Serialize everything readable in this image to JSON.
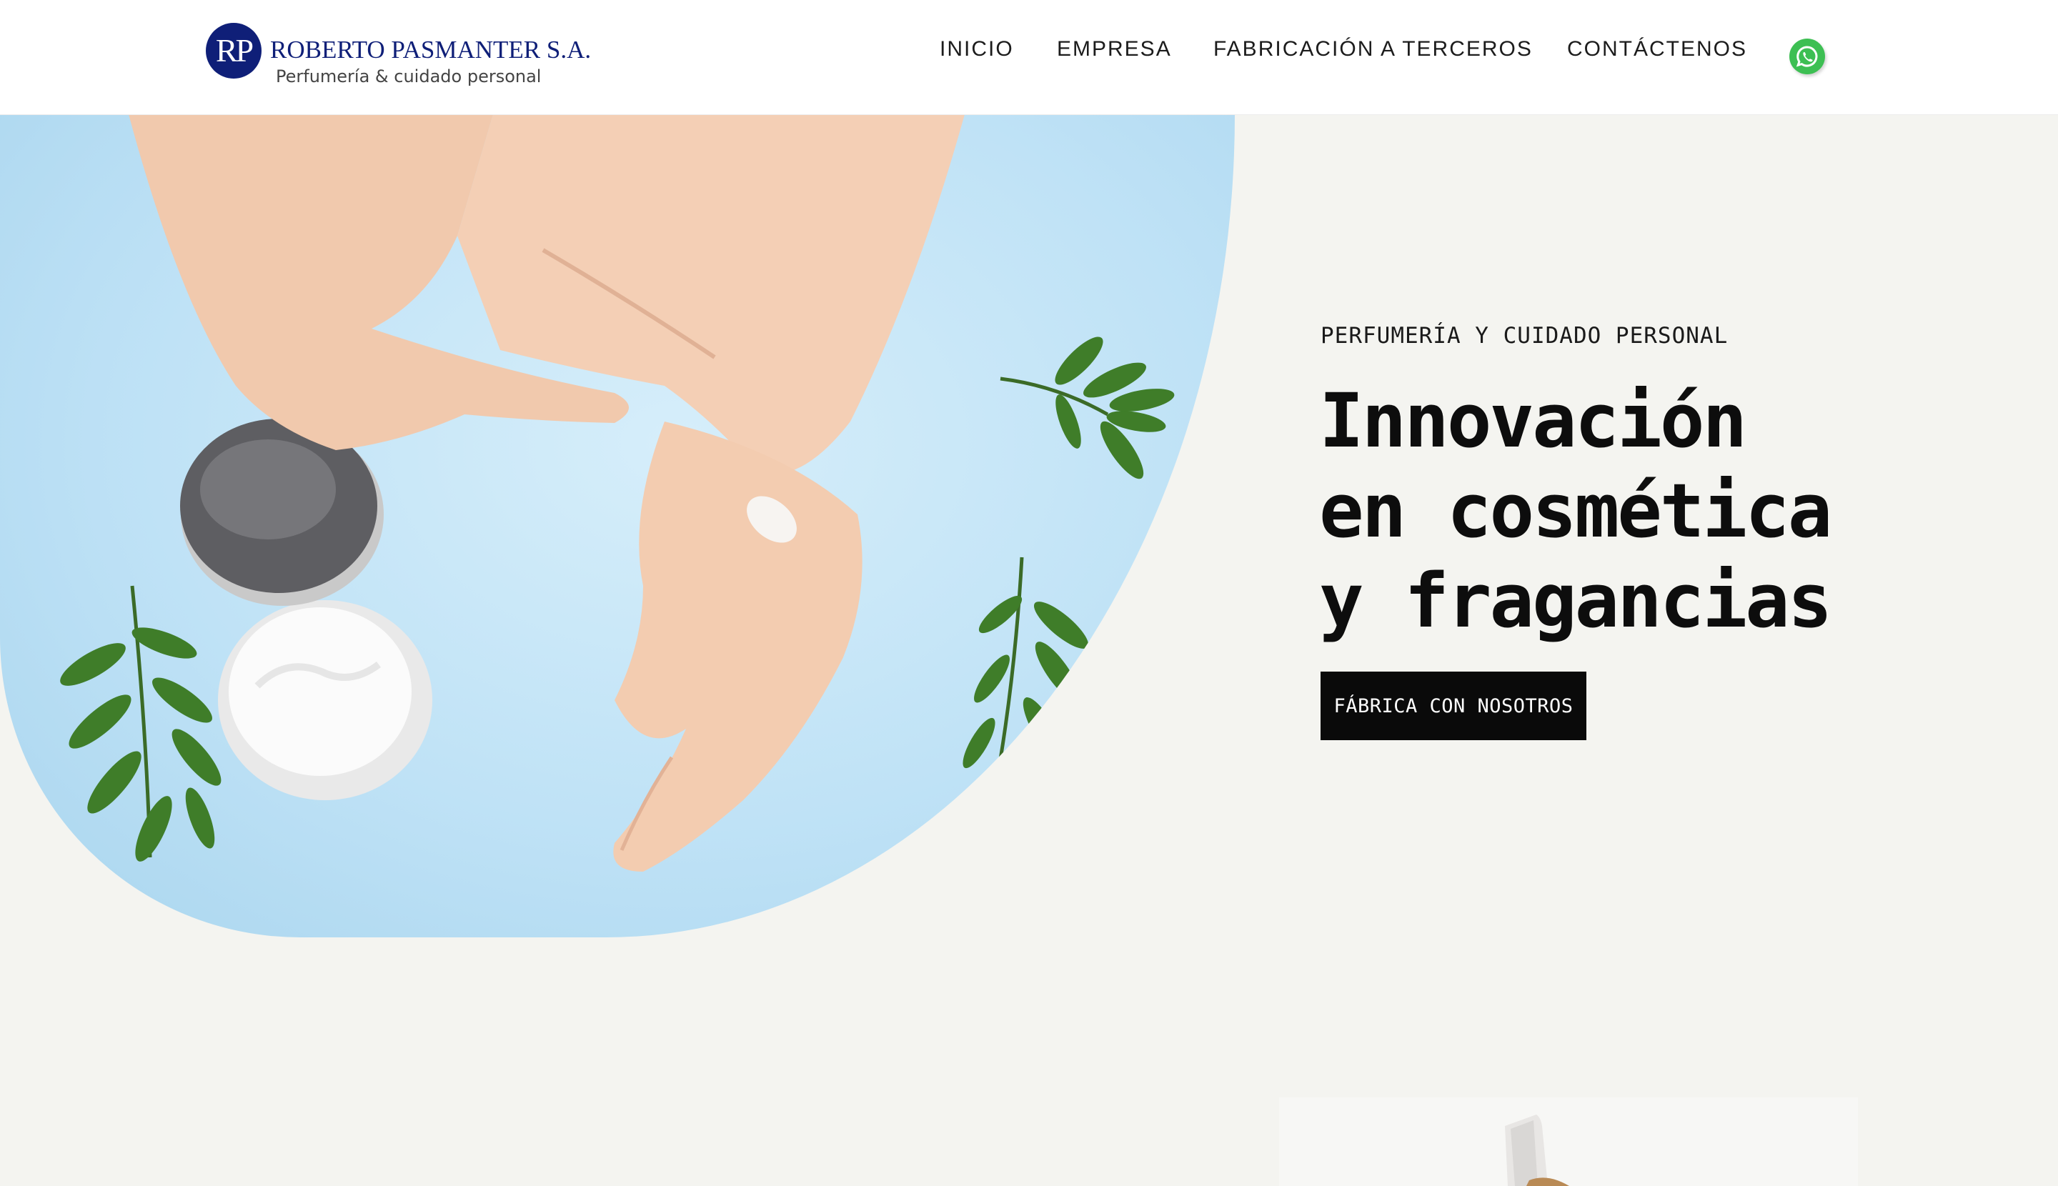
{
  "header": {
    "logo_mark": "RP",
    "logo_name": "ROBERTO PASMANTER S.A.",
    "logo_tagline": "Perfumería & cuidado personal",
    "nav": [
      {
        "label": "INICIO"
      },
      {
        "label": "EMPRESA"
      },
      {
        "label": "FABRICACIÓN A TERCEROS"
      },
      {
        "label": "CONTÁCTENOS"
      }
    ],
    "whatsapp_icon": "whatsapp-icon"
  },
  "hero": {
    "eyebrow": "PERFUMERÍA Y CUIDADO PERSONAL",
    "title_lines": [
      "Innovación",
      "en cosmética",
      "y fragancias"
    ],
    "cta_label": "FÁBRICA CON NOSOTROS"
  },
  "colors": {
    "brand_navy": "#0f1f78",
    "page_bg": "#f4f4f0",
    "hero_blue": "#bfe2f6",
    "cta_bg": "#0a0a0a",
    "whatsapp_green": "#3dbf53"
  }
}
